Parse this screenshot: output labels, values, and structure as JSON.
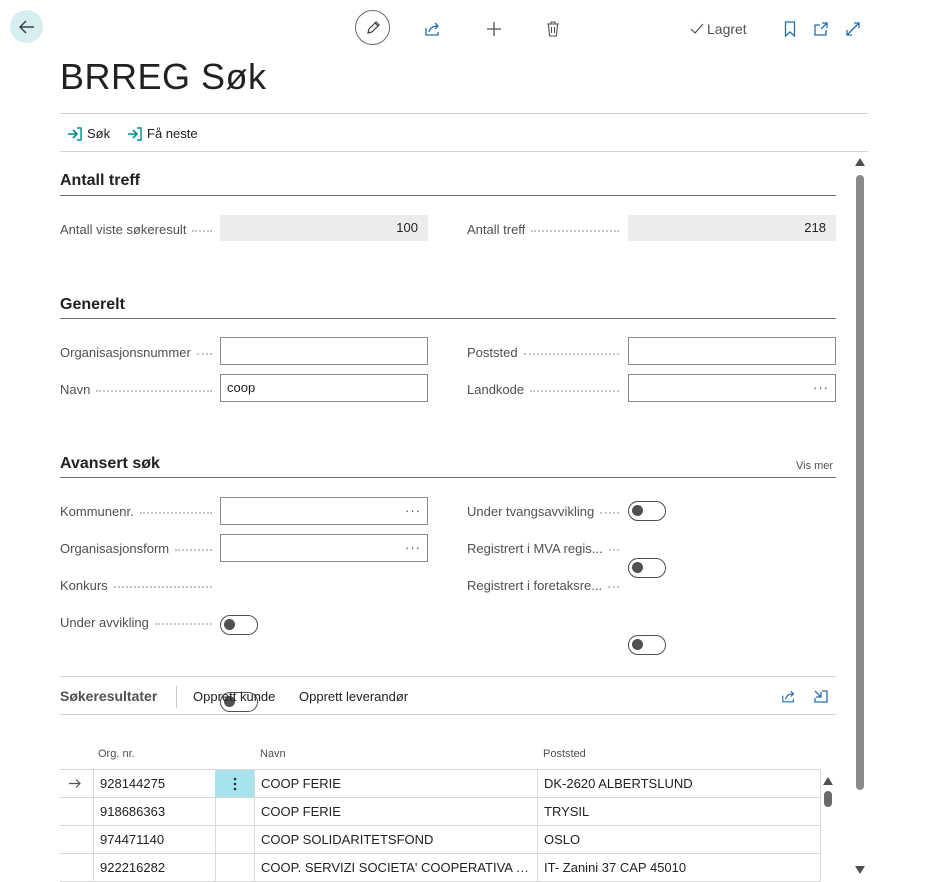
{
  "header": {
    "saved_label": "Lagret",
    "icons": [
      "back-arrow-icon",
      "pencil-icon",
      "share-icon",
      "plus-icon",
      "trash-icon",
      "check-icon",
      "bookmark-icon",
      "open-new-window-icon",
      "expand-icon"
    ]
  },
  "page": {
    "title": "BRREG Søk"
  },
  "actions": {
    "search_label": "Søk",
    "next_label": "Få neste"
  },
  "sections": {
    "count": {
      "title": "Antall treff",
      "shown_label": "Antall  viste søkeresult",
      "shown_value": "100",
      "total_label": "Antall treff",
      "total_value": "218"
    },
    "general": {
      "title": "Generelt",
      "orgnr_label": "Organisasjonsnummer",
      "orgnr_value": "",
      "poststed_label": "Poststed",
      "poststed_value": "",
      "navn_label": "Navn",
      "navn_value": "coop",
      "landkode_label": "Landkode",
      "landkode_value": ""
    },
    "advanced": {
      "title": "Avansert søk",
      "show_more": "Vis mer",
      "kommune_label": "Kommunenr.",
      "orgform_label": "Organisasjonsform",
      "konkurs_label": "Konkurs",
      "konkurs_on": false,
      "avvikling_label": "Under avvikling",
      "avvikling_on": false,
      "tvang_label": "Under tvangsavvikling",
      "tvang_on": false,
      "mva_label": "Registrert i MVA regis...",
      "mva_on": false,
      "foretak_label": "Registrert i foretaksre...",
      "foretak_on": false
    }
  },
  "results": {
    "title": "Søkeresultater",
    "create_customer": "Opprett kunde",
    "create_vendor": "Opprett leverandør",
    "columns": {
      "orgnr": "Org. nr.",
      "navn": "Navn",
      "poststed": "Poststed"
    },
    "rows": [
      {
        "orgnr": "928144275",
        "navn": "COOP FERIE",
        "poststed": "DK-2620 ALBERTSLUND"
      },
      {
        "orgnr": "918686363",
        "navn": "COOP FERIE",
        "poststed": "TRYSIL"
      },
      {
        "orgnr": "974471140",
        "navn": "COOP SOLIDARITETSFOND",
        "poststed": "OSLO"
      },
      {
        "orgnr": "922216282",
        "navn": "COOP. SERVIZI SOCIETA' COOPERATIVA DI L...",
        "poststed": "IT- Zanini 37 CAP 45010"
      }
    ]
  },
  "colors": {
    "accent": "#00a3a3",
    "selected_cell": "#a6e3ea",
    "back_button_bg": "#d6eef0"
  }
}
